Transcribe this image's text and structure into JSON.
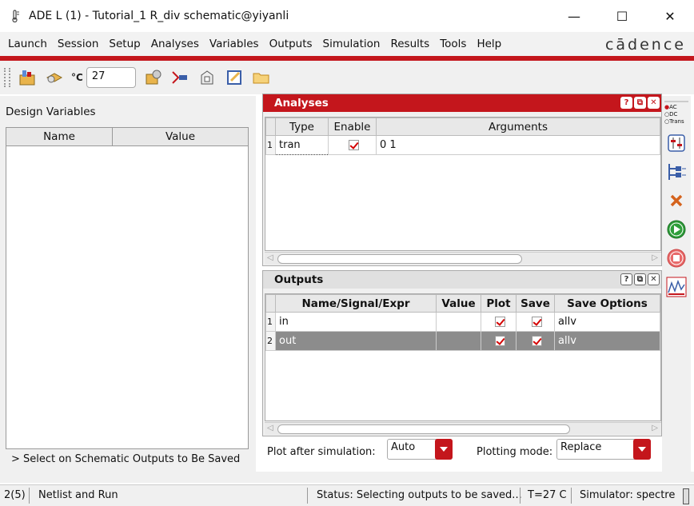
{
  "window": {
    "title": "ADE L (1) - Tutorial_1 R_div schematic@yiyanli",
    "minimize": "—",
    "maximize": "☐",
    "close": "✕"
  },
  "menu": {
    "items": [
      "Launch",
      "Session",
      "Setup",
      "Analyses",
      "Variables",
      "Outputs",
      "Simulation",
      "Results",
      "Tools",
      "Help"
    ],
    "brand": "cādence"
  },
  "toolbar": {
    "temp_unit": "°C",
    "temperature": "27"
  },
  "design_variables": {
    "title": "Design Variables",
    "columns": [
      "Name",
      "Value"
    ],
    "hint": "> Select on Schematic Outputs to Be Saved"
  },
  "analyses": {
    "title": "Analyses",
    "columns": [
      "Type",
      "Enable",
      "Arguments"
    ],
    "rows": [
      {
        "num": "1",
        "type": "tran",
        "enabled": true,
        "arguments": "0 1"
      }
    ]
  },
  "outputs": {
    "title": "Outputs",
    "columns": [
      "Name/Signal/Expr",
      "Value",
      "Plot",
      "Save",
      "Save Options"
    ],
    "rows": [
      {
        "num": "1",
        "name": "in",
        "value": "",
        "plot": true,
        "save": true,
        "save_options": "allv"
      },
      {
        "num": "2",
        "name": "out",
        "value": "",
        "plot": true,
        "save": true,
        "save_options": "allv"
      }
    ]
  },
  "panel_buttons": {
    "help": "?",
    "float": "⧉",
    "close": "✕"
  },
  "plot_controls": {
    "plot_after_label": "Plot after simulation:",
    "plot_after_value": "Auto",
    "plotting_mode_label": "Plotting mode:",
    "plotting_mode_value": "Replace"
  },
  "right_tools": {
    "analysis_options": [
      "AC",
      "DC",
      "Trans"
    ]
  },
  "status": {
    "count": "2(5)",
    "mode": "Netlist and Run",
    "status_text": "Status: Selecting outputs to be saved...",
    "temp": "T=27 C",
    "simulator": "Simulator: spectre"
  },
  "colors": {
    "accent": "#c4161c",
    "selected_row": "#8c8c8c"
  }
}
